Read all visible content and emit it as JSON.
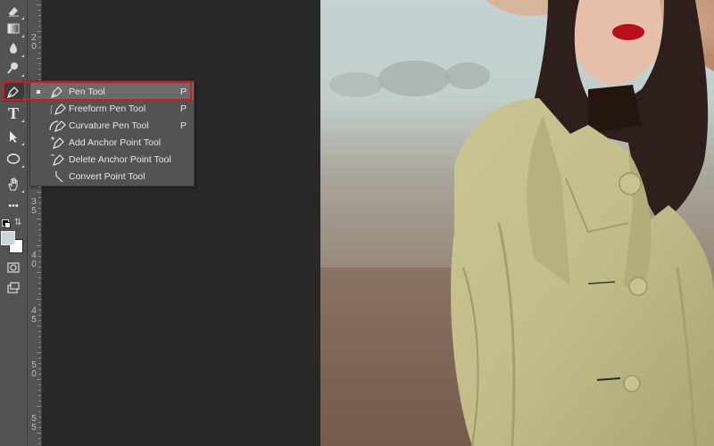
{
  "toolbar": {
    "tools": [
      {
        "name": "eraser-tool-icon"
      },
      {
        "name": "gradient-tool-icon"
      },
      {
        "name": "blur-tool-icon"
      },
      {
        "name": "dodge-tool-icon"
      },
      {
        "name": "pen-tool-icon",
        "active": true
      },
      {
        "name": "type-tool-icon",
        "glyph": "T"
      },
      {
        "name": "path-selection-tool-icon"
      },
      {
        "name": "ellipse-tool-icon"
      },
      {
        "name": "hand-tool-icon"
      },
      {
        "name": "more-tools-icon",
        "glyph": "•••"
      }
    ]
  },
  "ruler": {
    "labels": [
      {
        "digits": "2",
        "sub": "0"
      },
      {
        "digits": "3",
        "sub": "5"
      },
      {
        "digits": "4",
        "sub": "0"
      },
      {
        "digits": "4",
        "sub": "5"
      },
      {
        "digits": "5",
        "sub": "0"
      },
      {
        "digits": "5",
        "sub": "5"
      }
    ]
  },
  "flyout": {
    "items": [
      {
        "label": "Pen Tool",
        "shortcut": "P",
        "icon": "pen-icon",
        "selected": true
      },
      {
        "label": "Freeform Pen Tool",
        "shortcut": "P",
        "icon": "freeform-pen-icon"
      },
      {
        "label": "Curvature Pen Tool",
        "shortcut": "P",
        "icon": "curvature-pen-icon"
      },
      {
        "label": "Add Anchor Point Tool",
        "shortcut": "",
        "icon": "add-anchor-point-icon"
      },
      {
        "label": "Delete Anchor Point Tool",
        "shortcut": "",
        "icon": "delete-anchor-point-icon"
      },
      {
        "label": "Convert Point Tool",
        "shortcut": "",
        "icon": "convert-point-icon"
      }
    ]
  },
  "colors": {
    "highlight": "#e0141c",
    "foreground_swatch": "#c9d6dc",
    "background_swatch": "#ffffff"
  }
}
